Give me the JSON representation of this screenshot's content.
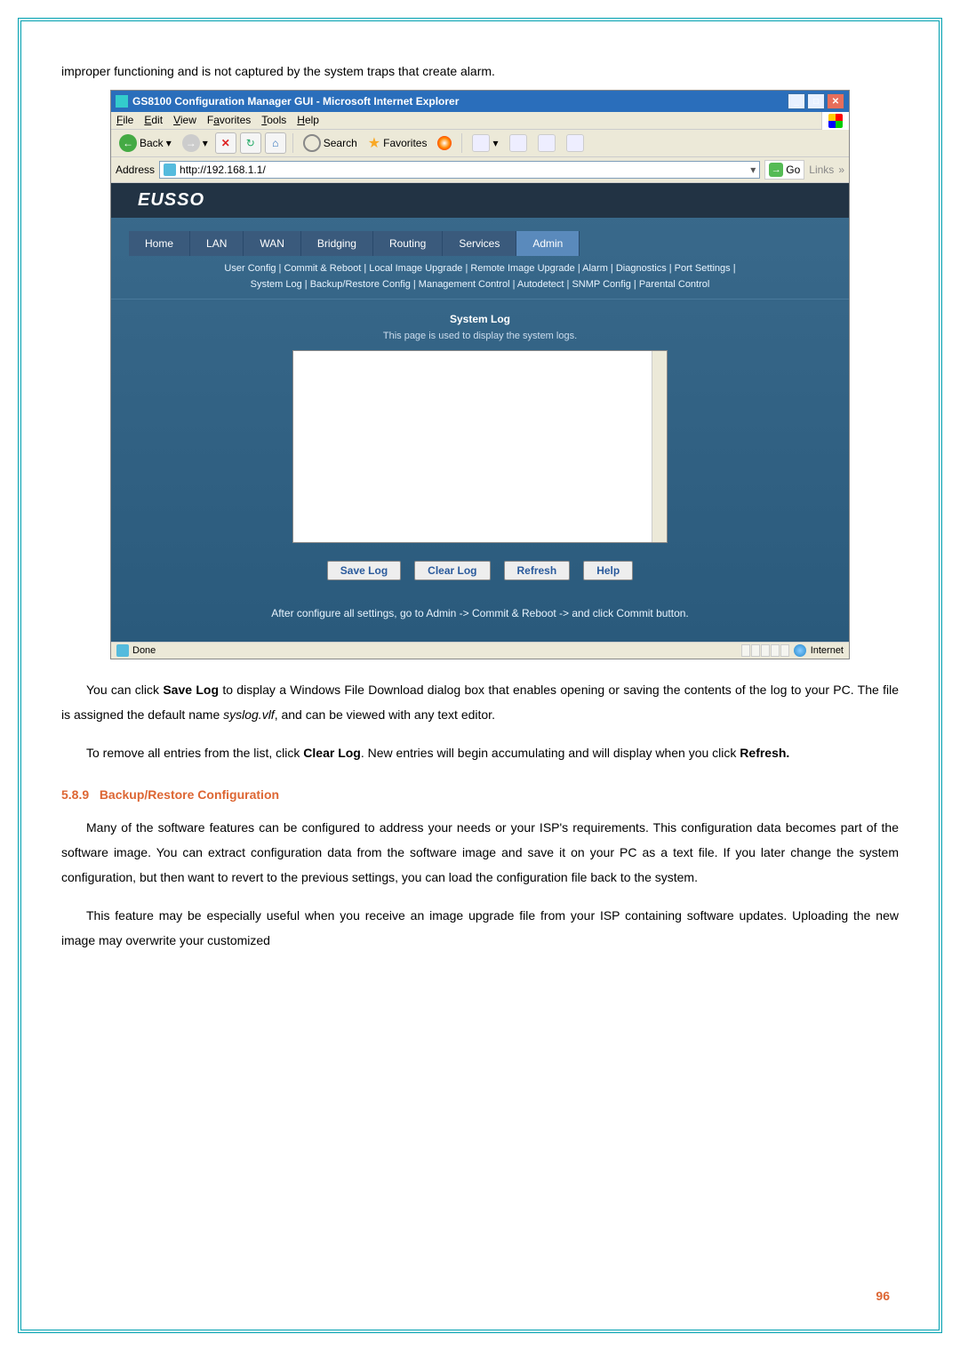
{
  "intro_line": "improper functioning and is not captured by the system traps that create alarm.",
  "window": {
    "title": "GS8100 Configuration Manager GUI - Microsoft Internet Explorer",
    "menus": {
      "file": "File",
      "edit": "Edit",
      "view": "View",
      "favorites": "Favorites",
      "tools": "Tools",
      "help": "Help"
    },
    "toolbar": {
      "back": "Back",
      "search": "Search",
      "favorites": "Favorites"
    },
    "address_label": "Address",
    "url": "http://192.168.1.1/",
    "go": "Go",
    "links": "Links",
    "statusbar": {
      "done": "Done",
      "zone": "Internet"
    }
  },
  "router": {
    "logo": "EUSSO",
    "tabs": [
      "Home",
      "LAN",
      "WAN",
      "Bridging",
      "Routing",
      "Services",
      "Admin"
    ],
    "active_tab": 6,
    "subnav_line1": "User Config  |  Commit & Reboot  |  Local Image Upgrade  |  Remote Image Upgrade  |  Alarm  |  Diagnostics  |  Port Settings  |",
    "subnav_line2": "System Log  |  Backup/Restore Config  |  Management Control  |  Autodetect  |  SNMP Config  |  Parental Control",
    "heading": "System Log",
    "subheading": "This page is used to display the system logs.",
    "buttons": {
      "save": "Save Log",
      "clear": "Clear Log",
      "refresh": "Refresh",
      "help": "Help"
    },
    "footer": "After configure all settings, go to Admin -> Commit & Reboot -> and click Commit button."
  },
  "para1_a": "You can click ",
  "para1_bold1": "Save Log",
  "para1_b": " to display a Windows File Download dialog box that enables opening or saving the contents of the log to your PC. The file is assigned the default name ",
  "para1_italic": "syslog.vlf",
  "para1_c": ", and can be viewed with any text editor.",
  "para2_a": "To remove all entries from the list, click ",
  "para2_bold1": "Clear Log",
  "para2_b": ". New entries will begin accumulating and will display when you click ",
  "para2_bold2": "Refresh.",
  "section_num": "5.8.9",
  "section_title": "Backup/Restore Configuration",
  "para3": "Many of the software features can be configured to address your needs or your ISP's requirements. This configuration data becomes part of the software image. You can extract configuration data from the software image and save it on your PC as a text file. If you later change the system configuration, but then want to revert to the previous settings, you can load the configuration file back to the system.",
  "para4": "This feature may be especially useful when you receive an image upgrade file from your ISP containing software updates. Uploading the new image may overwrite your customized",
  "page_number": "96"
}
